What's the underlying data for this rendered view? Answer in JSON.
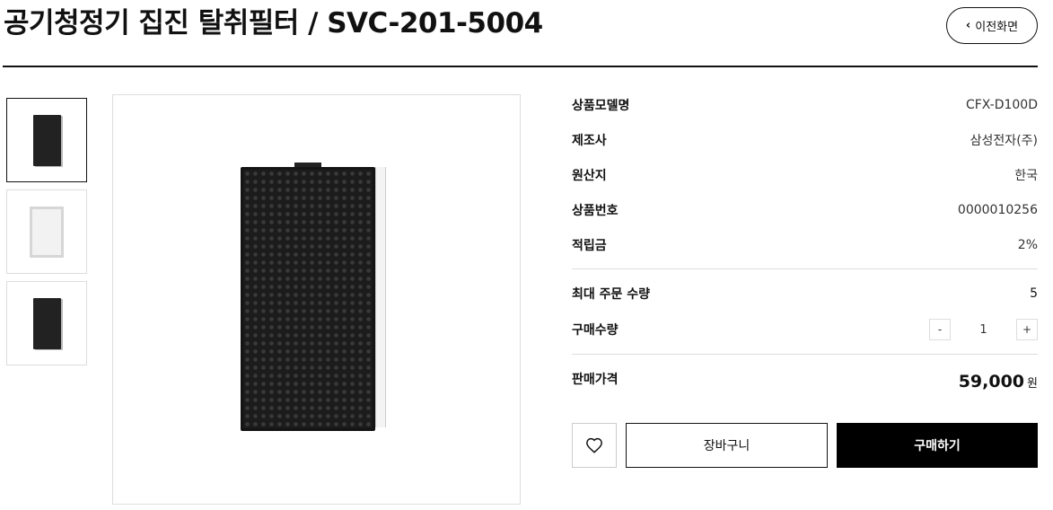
{
  "header": {
    "title": "공기청정기 집진 탈취필터 / SVC-201-5004",
    "back_label": "이전화면"
  },
  "thumbnails": [
    {
      "alt": "deodorizing filter front",
      "active": true
    },
    {
      "alt": "dust collecting filter",
      "active": false
    },
    {
      "alt": "deodorizing filter side",
      "active": false
    }
  ],
  "specs": [
    {
      "label": "상품모델명",
      "value": "CFX-D100D"
    },
    {
      "label": "제조사",
      "value": "삼성전자(주)"
    },
    {
      "label": "원산지",
      "value": "한국"
    },
    {
      "label": "상품번호",
      "value": "0000010256"
    },
    {
      "label": "적립금",
      "value": "2%"
    }
  ],
  "max_order": {
    "label": "최대 주문 수량",
    "value": "5"
  },
  "quantity": {
    "label": "구매수량",
    "minus": "-",
    "value": "1",
    "plus": "+"
  },
  "price": {
    "label": "판매가격",
    "amount": "59,000",
    "unit": "원"
  },
  "actions": {
    "cart_label": "장바구니",
    "buy_label": "구매하기"
  }
}
